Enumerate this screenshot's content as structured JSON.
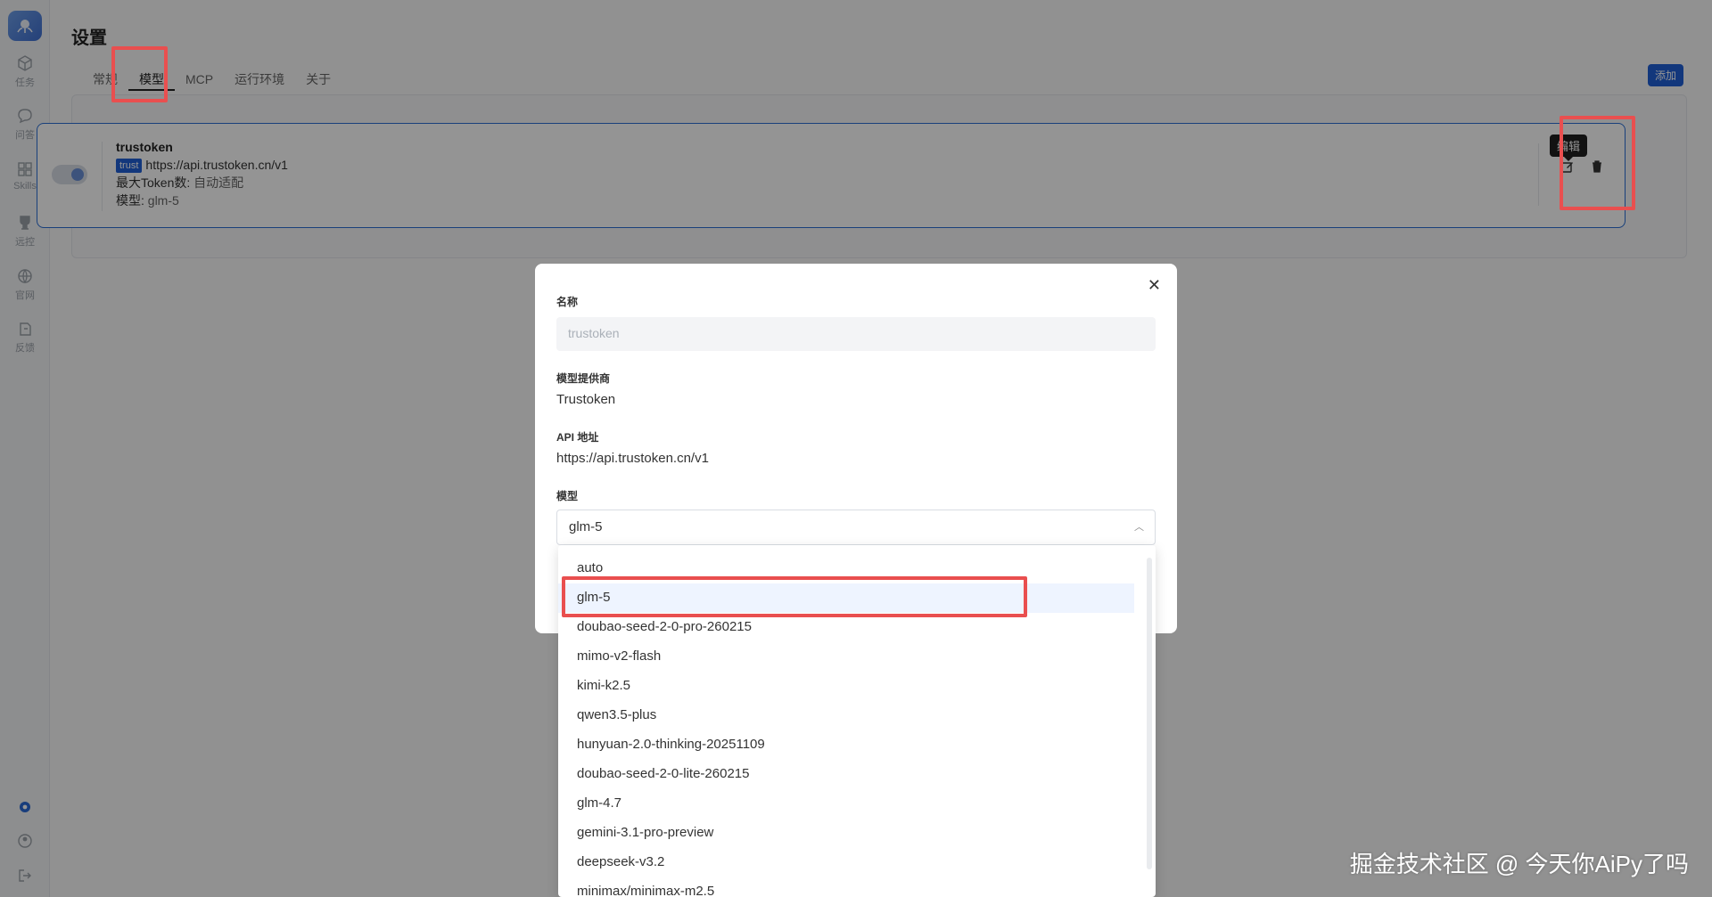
{
  "sidebar": {
    "items": [
      {
        "label": "任务",
        "icon": "cube-icon"
      },
      {
        "label": "问答",
        "icon": "chat-icon"
      },
      {
        "label": "Skills",
        "icon": "grid-icon"
      },
      {
        "label": "远控",
        "icon": "trophy-icon"
      },
      {
        "label": "官网",
        "icon": "globe-icon"
      },
      {
        "label": "反馈",
        "icon": "feedback-icon"
      }
    ]
  },
  "page": {
    "title": "设置",
    "tabs": [
      "常规",
      "模型",
      "MCP",
      "运行环境",
      "关于"
    ],
    "active_tab": "模型",
    "add_label": "添加"
  },
  "card": {
    "name": "trustoken",
    "badge": "trust",
    "url": "https://api.trustoken.cn/v1",
    "max_token_label": "最大Token数:",
    "max_token_value": "自动适配",
    "model_label": "模型:",
    "model_value": "glm-5",
    "tooltip": "编辑"
  },
  "modal": {
    "name_label": "名称",
    "name_value": "trustoken",
    "provider_label": "模型提供商",
    "provider_value": "Trustoken",
    "api_label": "API 地址",
    "api_value": "https://api.trustoken.cn/v1",
    "model_label": "模型",
    "model_selected": "glm-5"
  },
  "dropdown": {
    "options": [
      "auto",
      "glm-5",
      "doubao-seed-2-0-pro-260215",
      "mimo-v2-flash",
      "kimi-k2.5",
      "qwen3.5-plus",
      "hunyuan-2.0-thinking-20251109",
      "doubao-seed-2-0-lite-260215",
      "glm-4.7",
      "gemini-3.1-pro-preview",
      "deepseek-v3.2",
      "minimax/minimax-m2.5"
    ],
    "selected_index": 1
  },
  "watermark": "掘金技术社区 @ 今天你AiPy了吗",
  "colors": {
    "accent": "#1f5fd6",
    "highlight": "#e94f4f"
  }
}
